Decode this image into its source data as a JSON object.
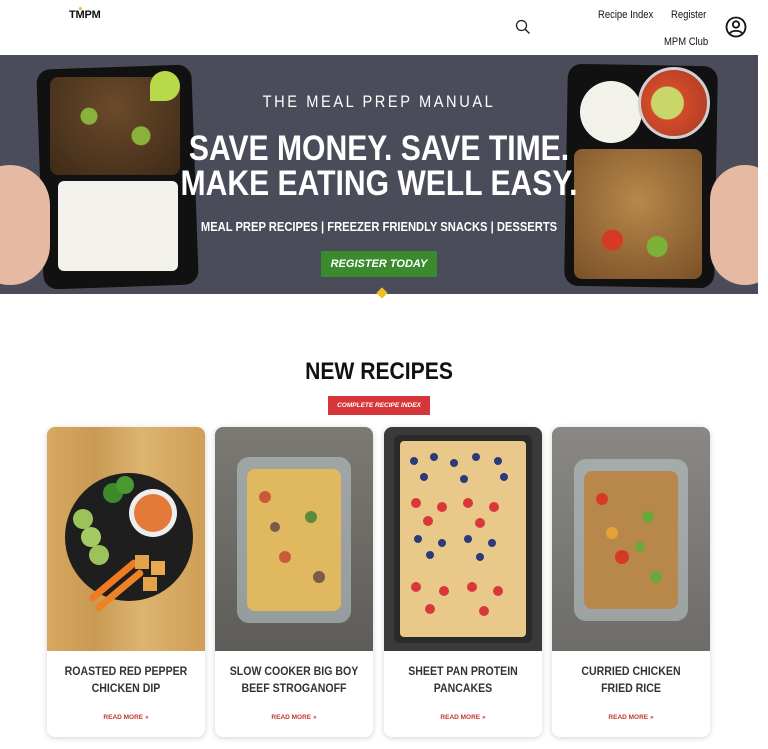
{
  "header": {
    "logo": "TMPM",
    "nav": {
      "recipe_index": "Recipe Index",
      "register": "Register",
      "club": "MPM Club"
    }
  },
  "hero": {
    "brand": "THE MEAL PREP MANUAL",
    "title_line1": "SAVE MONEY. SAVE TIME.",
    "title_line2": "MAKE EATING WELL EASY.",
    "subtitle": "MEAL PREP RECIPES | FREEZER FRIENDLY SNACKS | DESSERTS",
    "cta": "REGISTER TODAY"
  },
  "recipes": {
    "heading": "NEW RECIPES",
    "index_button": "COMPLETE RECIPE INDEX",
    "items": [
      {
        "title": "ROASTED RED PEPPER CHICKEN DIP",
        "link": "READ MORE »"
      },
      {
        "title": "SLOW COOKER BIG BOY BEEF STROGANOFF",
        "link": "READ MORE »"
      },
      {
        "title": "SHEET PAN PROTEIN PANCAKES",
        "link": "READ MORE »"
      },
      {
        "title": "CURRIED CHICKEN FRIED RICE",
        "link": "READ MORE »"
      }
    ]
  },
  "colors": {
    "hero_bg": "#4a4c59",
    "cta_green": "#3b8a2e",
    "index_red": "#d6363a",
    "link_red": "#c0392b"
  },
  "icons": [
    "search-icon",
    "account-icon"
  ]
}
